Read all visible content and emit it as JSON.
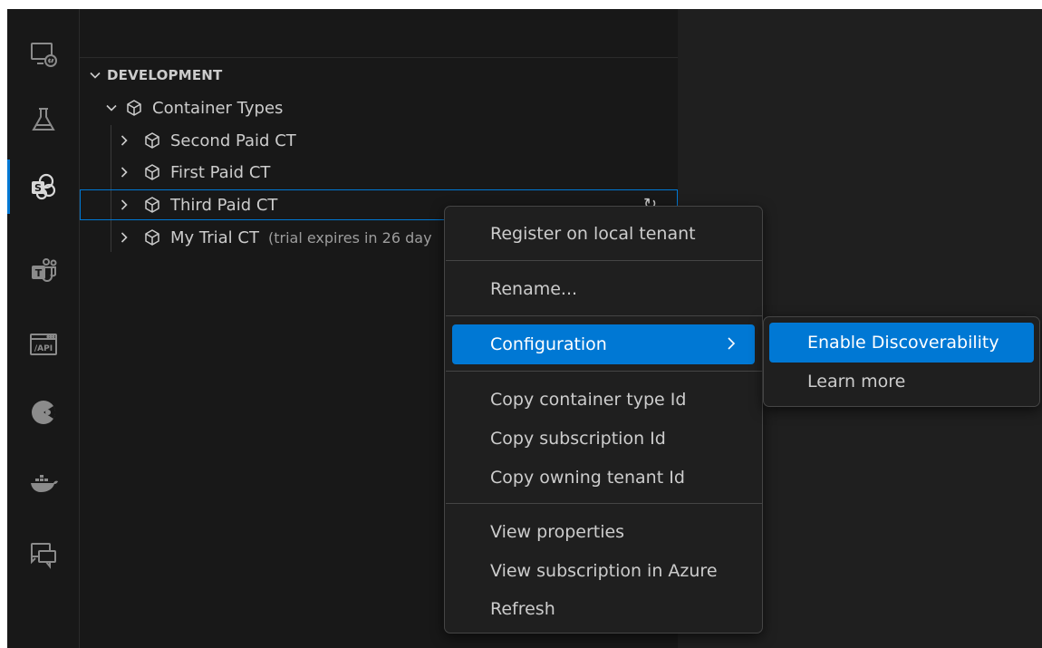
{
  "sidebar": {
    "section_title": "DEVELOPMENT",
    "tree": {
      "root_label": "Container Types",
      "items": [
        {
          "label": "Second Paid CT",
          "description": ""
        },
        {
          "label": "First Paid CT",
          "description": ""
        },
        {
          "label": "Third Paid CT",
          "description": "",
          "selected": true
        },
        {
          "label": "My Trial CT",
          "description": "(trial expires in 26 day"
        }
      ],
      "refresh_glyph": "↻"
    }
  },
  "activity_bar": {
    "items": [
      {
        "icon": "remote-explorer-icon"
      },
      {
        "icon": "testing-flask-icon"
      },
      {
        "icon": "sharepoint-embedded-icon",
        "active": true
      },
      {
        "icon": "teams-toolkit-icon"
      },
      {
        "icon": "api-center-icon",
        "text": "/API"
      },
      {
        "icon": "kubernetes-pie-icon"
      },
      {
        "icon": "docker-whale-icon"
      },
      {
        "icon": "chat-feedback-icon"
      }
    ]
  },
  "context_menu": {
    "items": [
      {
        "label": "Register on local tenant"
      },
      {
        "label": "Rename..."
      },
      {
        "label": "Configuration",
        "has_submenu": true
      },
      {
        "label": "Copy container type Id"
      },
      {
        "label": "Copy subscription Id"
      },
      {
        "label": "Copy owning tenant Id"
      },
      {
        "label": "View properties"
      },
      {
        "label": "View subscription in Azure"
      },
      {
        "label": "Refresh"
      }
    ]
  },
  "submenu": {
    "items": [
      {
        "label": "Enable Discoverability"
      },
      {
        "label": "Learn more"
      }
    ]
  },
  "colors": {
    "accent": "#0078d4",
    "menu_bg": "#1f1f1f",
    "sidebar_bg": "#181818",
    "text": "#cccccc"
  }
}
